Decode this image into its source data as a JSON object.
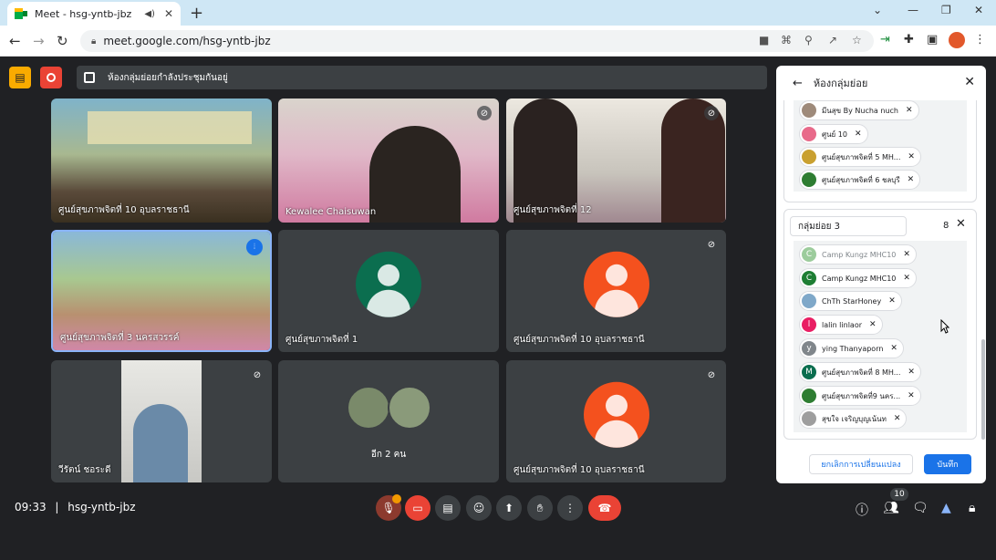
{
  "browser": {
    "tab_title": "Meet - hsg-yntb-jbz",
    "url": "meet.google.com/hsg-yntb-jbz"
  },
  "meet": {
    "room_label": "ห้องกลุ่มย่อยกำลังประชุมกันอยู่",
    "time": "09:33",
    "meeting_code": "hsg-yntb-jbz",
    "people_count": "10"
  },
  "tiles": [
    {
      "name": "ศูนย์สุขภาพจิตที่ 10 อุบลราชธานี",
      "kind": "video",
      "color": "#8a9a7a"
    },
    {
      "name": "Kewalee Chaisuwan",
      "kind": "video",
      "color": "#c88aa8"
    },
    {
      "name": "ศูนย์สุขภาพจิตที่ 12",
      "kind": "video",
      "color": "#b8b0a8"
    },
    {
      "name": "ศูนย์สุขภาพจิตที่ 3 นครสวรรค์",
      "kind": "video",
      "color": "#7a9a6a"
    },
    {
      "name": "ศูนย์สุขภาพจิตที่ 1",
      "kind": "avatar",
      "color": "#0b6e4f"
    },
    {
      "name": "ศูนย์สุขภาพจิตที่ 10 อุบลราชธานี",
      "kind": "avatar",
      "color": "#f4511e"
    },
    {
      "name": "วีรัตน์ ชอระดี",
      "kind": "video",
      "color": "#8a8880"
    },
    {
      "name": "อีก 2 คน",
      "kind": "group",
      "color": "#3c4043"
    },
    {
      "name": "ศูนย์สุขภาพจิตที่ 10 อุบลราชธานี",
      "kind": "avatar",
      "color": "#f4511e"
    }
  ],
  "panel": {
    "title": "ห้องกลุ่มย่อย",
    "group1_members": [
      {
        "name": "มีนสุข By Nucha nuch",
        "initial": "",
        "color": "#9e8a7a"
      },
      {
        "name": "ศูนย์ 10",
        "initial": "",
        "color": "#e86a8a"
      },
      {
        "name": "ศูนย์สุขภาพจิตที่ 5 MH...",
        "initial": "",
        "color": "#c9a030"
      },
      {
        "name": "ศูนย์สุขภาพจิตที่ 6 ชลบุรี",
        "initial": "",
        "color": "#2e7d32"
      }
    ],
    "group3_name": "กลุ่มย่อย 3",
    "group3_count": "8",
    "group3_members": [
      {
        "name": "Camp Kungz MHC10",
        "initial": "C",
        "color": "#9ccc9c"
      },
      {
        "name": "Camp Kungz MHC10",
        "initial": "C",
        "color": "#1e7e34"
      },
      {
        "name": "ChTh StarHoney",
        "initial": "",
        "color": "#7fa8c9"
      },
      {
        "name": "lalin linlaor",
        "initial": "l",
        "color": "#e91e63"
      },
      {
        "name": "ying Thanyaporn",
        "initial": "y",
        "color": "#80868b"
      },
      {
        "name": "ศูนย์สุขภาพจิตที่ 8 MH...",
        "initial": "M",
        "color": "#0b6e4f"
      },
      {
        "name": "ศูนย์สุขภาพจิตที่9 นคร...",
        "initial": "",
        "color": "#2e7d32"
      },
      {
        "name": "สุขใจ เจริญบุญเน้นท",
        "initial": "",
        "color": "#9e9e9e"
      }
    ],
    "cancel_label": "ยกเลิกการเปลี่ยนแปลง",
    "save_label": "บันทึก"
  }
}
